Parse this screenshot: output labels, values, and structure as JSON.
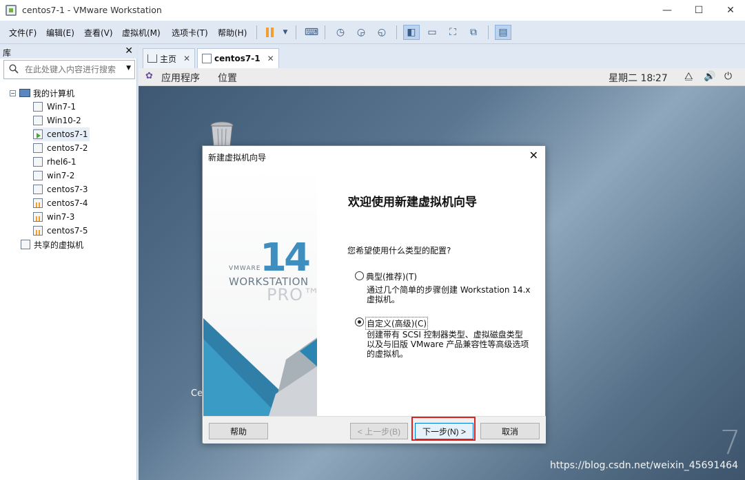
{
  "window": {
    "title": "centos7-1 - VMware Workstation",
    "min": "—",
    "max": "☐",
    "close": "✕"
  },
  "menu": [
    "文件(F)",
    "编辑(E)",
    "查看(V)",
    "虚拟机(M)",
    "选项卡(T)",
    "帮助(H)"
  ],
  "library": {
    "title": "库",
    "close": "✕",
    "search_placeholder": "在此处键入内容进行搜索",
    "root": "我的计算机",
    "items": [
      {
        "label": "Win7-1",
        "state": "off"
      },
      {
        "label": "Win10-2",
        "state": "off"
      },
      {
        "label": "centos7-1",
        "state": "running",
        "selected": true
      },
      {
        "label": "centos7-2",
        "state": "off"
      },
      {
        "label": "rhel6-1",
        "state": "off"
      },
      {
        "label": "win7-2",
        "state": "off"
      },
      {
        "label": "centos7-3",
        "state": "off"
      },
      {
        "label": "centos7-4",
        "state": "paused"
      },
      {
        "label": "win7-3",
        "state": "paused"
      },
      {
        "label": "centos7-5",
        "state": "paused"
      }
    ],
    "shared": "共享的虚拟机"
  },
  "tabs": [
    {
      "label": "主页",
      "close": "✕"
    },
    {
      "label": "centos7-1",
      "close": "✕"
    }
  ],
  "guest": {
    "apps": "应用程序",
    "places": "位置",
    "clock": "星期二 18∶27"
  },
  "desktop": {
    "icon_label": "Ce",
    "seven": "7",
    "watermark": "https://blog.csdn.net/weixin_45691464"
  },
  "dialog": {
    "title": "新建虚拟机向导",
    "close": "✕",
    "logo": {
      "vmware": "VMWARE",
      "number": "14",
      "workstation": "WORKSTATION",
      "pro": "PRO™"
    },
    "heading": "欢迎使用新建虚拟机向导",
    "question": "您希望使用什么类型的配置?",
    "options": [
      {
        "label": "典型(推荐)(T)",
        "desc1": "通过几个简单的步骤创建 Workstation 14.x",
        "desc2": "虚拟机。",
        "desc3": "",
        "checked": false
      },
      {
        "label": "自定义(高级)(C)",
        "desc1": "创建带有 SCSI 控制器类型、虚拟磁盘类型",
        "desc2": "以及与旧版 VMware 产品兼容性等高级选项",
        "desc3": "的虚拟机。",
        "checked": true
      }
    ],
    "buttons": {
      "help": "帮助",
      "back": "< 上一步(B)",
      "next": "下一步(N) >",
      "cancel": "取消"
    }
  }
}
